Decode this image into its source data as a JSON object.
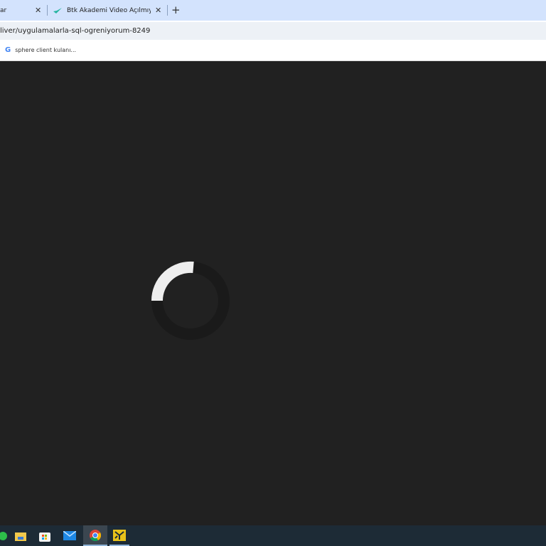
{
  "tabs": [
    {
      "title": "ar",
      "icon": "page-icon"
    },
    {
      "title": "Btk Akademi Video Açılmıyor S",
      "icon": "btk-favicon"
    }
  ],
  "new_tab_label": "+",
  "close_label": "✕",
  "address_bar": {
    "url": "liver/uygulamalarla-sql-ogreniyorum-8249"
  },
  "bookmarks": [
    {
      "label": "sphere client kulanı...",
      "icon": "google-icon"
    }
  ],
  "content": {
    "state": "loading",
    "spinner_icon": "loading-spinner"
  },
  "taskbar": {
    "apps": [
      "file-explorer",
      "microsoft-store",
      "mail",
      "chrome",
      "app-yellow"
    ],
    "active": "chrome"
  },
  "colors": {
    "tabstrip": "#d3e3fd",
    "content_bg": "#212121",
    "spinner": "#eeeeee",
    "taskbar": "#1d2b36"
  }
}
